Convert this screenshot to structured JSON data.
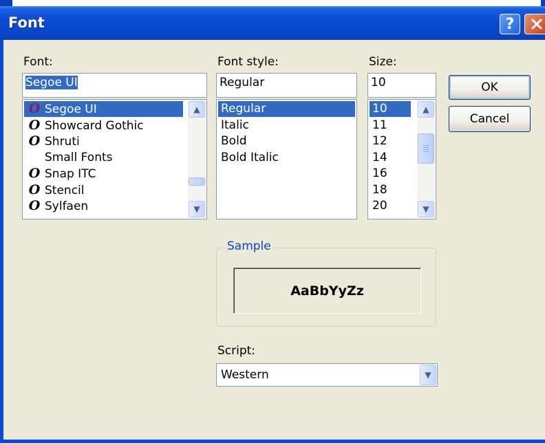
{
  "dialog": {
    "title": "Font"
  },
  "font": {
    "label": "Font:",
    "value": "Segoe UI",
    "items": [
      {
        "name": "Segoe UI",
        "icon": "opentype-icon",
        "selected": true
      },
      {
        "name": "Showcard Gothic",
        "icon": "opentype-icon",
        "selected": false
      },
      {
        "name": "Shruti",
        "icon": "opentype-icon",
        "selected": false
      },
      {
        "name": "Small Fonts",
        "icon": "",
        "selected": false
      },
      {
        "name": "Snap ITC",
        "icon": "opentype-icon",
        "selected": false
      },
      {
        "name": "Stencil",
        "icon": "opentype-icon",
        "selected": false
      },
      {
        "name": "Sylfaen",
        "icon": "opentype-icon",
        "selected": false
      }
    ]
  },
  "font_style": {
    "label": "Font style:",
    "value": "Regular",
    "items": [
      {
        "name": "Regular",
        "selected": true
      },
      {
        "name": "Italic",
        "selected": false
      },
      {
        "name": "Bold",
        "selected": false
      },
      {
        "name": "Bold Italic",
        "selected": false
      }
    ]
  },
  "size": {
    "label": "Size:",
    "value": "10",
    "items": [
      {
        "name": "10",
        "selected": true
      },
      {
        "name": "11",
        "selected": false
      },
      {
        "name": "12",
        "selected": false
      },
      {
        "name": "14",
        "selected": false
      },
      {
        "name": "16",
        "selected": false
      },
      {
        "name": "18",
        "selected": false
      },
      {
        "name": "20",
        "selected": false
      }
    ]
  },
  "buttons": {
    "ok": "OK",
    "cancel": "Cancel"
  },
  "sample": {
    "label": "Sample",
    "text": "AaBbYyZz"
  },
  "script": {
    "label": "Script:",
    "value": "Western"
  },
  "colors": {
    "selection": "#316ac5",
    "titlebar": "#0a4ad3",
    "group_label": "#0046d5"
  }
}
